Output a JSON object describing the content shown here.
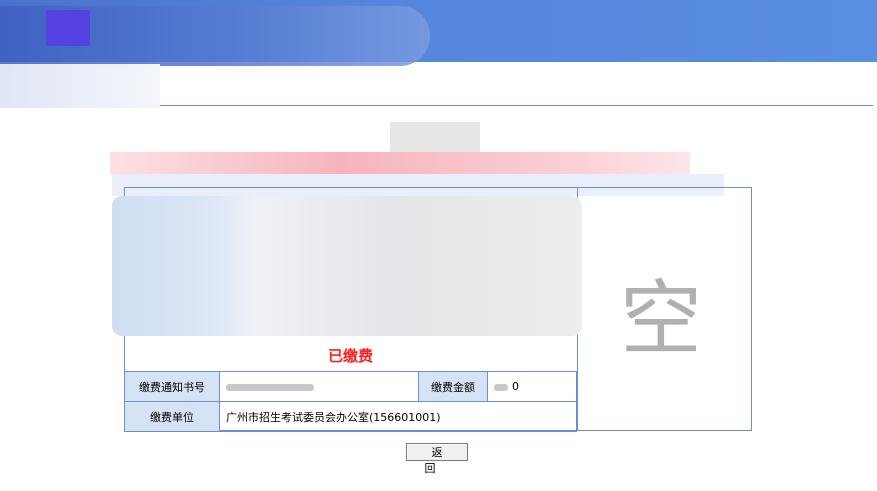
{
  "header": {
    "title": ""
  },
  "status": {
    "text": "已缴费"
  },
  "fee_table": {
    "notice_label": "缴费通知书号",
    "amount_label": "缴费金额",
    "amount_value": "0",
    "unit_label": "缴费单位",
    "unit_value": "广州市招生考试委员会办公室(156601001)"
  },
  "photo": {
    "glyph": "空"
  },
  "buttons": {
    "back_label": "返 回"
  },
  "colors": {
    "banner": "#5587dc",
    "border": "#6b8fd1",
    "label_bg": "#d6e3f5",
    "status": "#ff1e1e"
  }
}
